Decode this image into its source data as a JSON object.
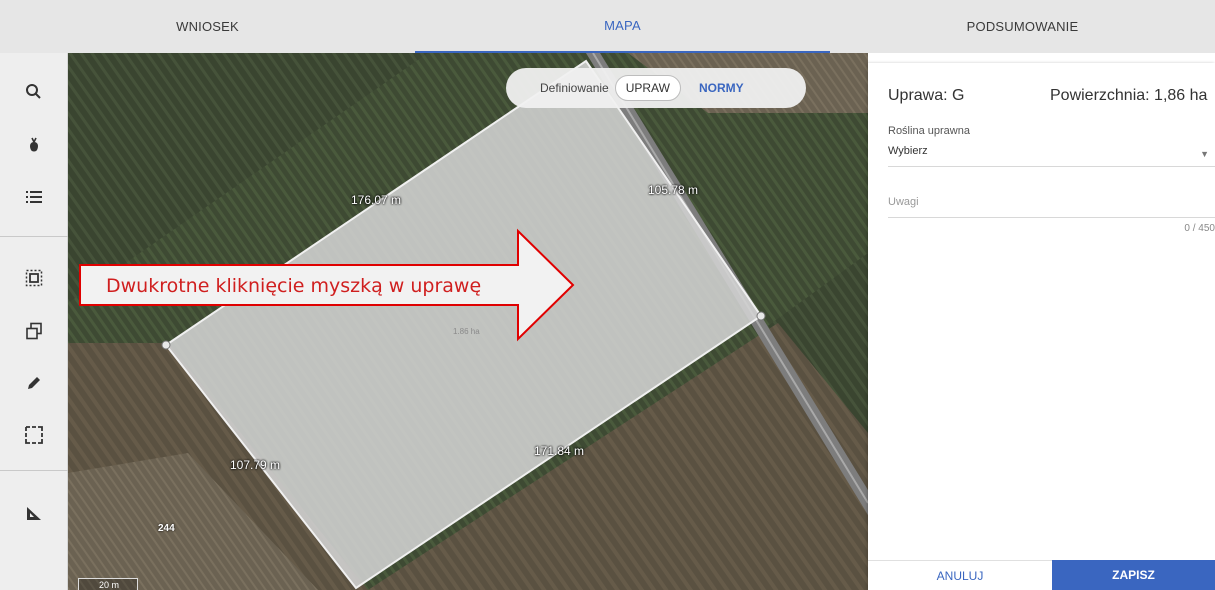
{
  "tabs": [
    {
      "label": "WNIOSEK"
    },
    {
      "label": "MAPA"
    },
    {
      "label": "PODSUMOWANIE"
    }
  ],
  "active_tab": "MAPA",
  "toolbar": {
    "icons": [
      "search-icon",
      "plant-icon",
      "list-icon",
      "select-area-icon",
      "copy-icon",
      "pencil-icon",
      "rectangle-select-icon",
      "measure-icon"
    ]
  },
  "map": {
    "toggle": {
      "label": "Definiowanie",
      "options": [
        "UPRAW",
        "NORMY"
      ],
      "active": "UPRAW"
    },
    "dimensions": {
      "top": "176.07 m",
      "right": "105.78 m",
      "bottom": "171.84 m",
      "left": "107.79 m"
    },
    "area_label": "1.86 ha",
    "parcel_number": "244",
    "scale_label": "20 m",
    "annotation": "Dwukrotne kliknięcie myszką w uprawę"
  },
  "panel": {
    "title": "Uprawa: G",
    "area": "Powierzchnia: 1,86 ha",
    "crop_label": "Roślina uprawna",
    "crop_value": "Wybierz",
    "notes_placeholder": "Uwagi",
    "notes_counter": "0 / 450",
    "cancel_label": "ANULUJ",
    "save_label": "ZAPISZ"
  },
  "colors": {
    "accent": "#3a66c0",
    "annotation_red": "#d01f1f"
  }
}
